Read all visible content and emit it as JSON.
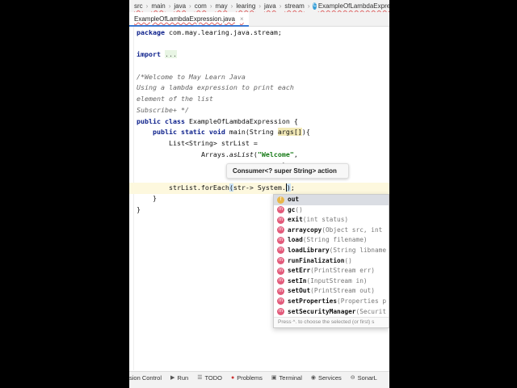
{
  "breadcrumb": [
    "src",
    "main",
    "java",
    "com",
    "may",
    "learing",
    "java",
    "stream"
  ],
  "breadcrumb_file": "ExampleOfLambdaExpression",
  "tab": {
    "label": "ExampleOfLambdaExpression.java",
    "close": "×"
  },
  "code": {
    "l1_kw": "package",
    "l1_rest": " com.may.learing.java.stream;",
    "l3_kw": "import",
    "l3_fold": "...",
    "c1": "/*Welcome to May Learn Java",
    "c2": "Using a lambda expression to print each",
    "c3": "element of the list",
    "c4": "Subscribe+ */",
    "l9_kw": "public class",
    "l9_rest": " ExampleOfLambdaExpression {",
    "l10_kw": "public static void",
    "l10_a": " main(String ",
    "l10_hl": "args[]",
    "l10_b": "){",
    "l11": "List<String> strList =",
    "l12_a": "Arrays.",
    "l12_it": "asList",
    "l12_b": "(",
    "l12_st": "\"Welcome\"",
    "l12_c": ",",
    "l13": ");",
    "l15_a": "strList.forEach",
    "l15_br": "(",
    "l15_b": "str-> System.",
    "l15_cur": ")",
    "l15_c": ";",
    "l16": "}",
    "l17": "}"
  },
  "tooltip": "Consumer<? super String> action",
  "completion": {
    "items": [
      {
        "icon": "f",
        "name": "out",
        "params": ""
      },
      {
        "icon": "m",
        "name": "gc",
        "params": "()"
      },
      {
        "icon": "m",
        "name": "exit",
        "params": "(int status)"
      },
      {
        "icon": "m",
        "name": "arraycopy",
        "params": "(Object src, int"
      },
      {
        "icon": "m",
        "name": "load",
        "params": "(String filename)"
      },
      {
        "icon": "m",
        "name": "loadLibrary",
        "params": "(String libname"
      },
      {
        "icon": "m",
        "name": "runFinalization",
        "params": "()"
      },
      {
        "icon": "m",
        "name": "setErr",
        "params": "(PrintStream err)"
      },
      {
        "icon": "m",
        "name": "setIn",
        "params": "(InputStream in)"
      },
      {
        "icon": "m",
        "name": "setOut",
        "params": "(PrintStream out)"
      },
      {
        "icon": "m",
        "name": "setProperties",
        "params": "(Properties p"
      },
      {
        "icon": "m",
        "name": "setSecurityManager",
        "params": "(Securit"
      }
    ],
    "hint": "Press ^. to choose the selected (or first) s"
  },
  "toolbar": [
    {
      "icon": "",
      "label": "sion Control"
    },
    {
      "icon": "▶",
      "label": "Run"
    },
    {
      "icon": "☰",
      "label": "TODO"
    },
    {
      "icon": "●",
      "label": "Problems"
    },
    {
      "icon": "▣",
      "label": "Terminal"
    },
    {
      "icon": "◉",
      "label": "Services"
    },
    {
      "icon": "⊖",
      "label": "SonarL"
    }
  ]
}
